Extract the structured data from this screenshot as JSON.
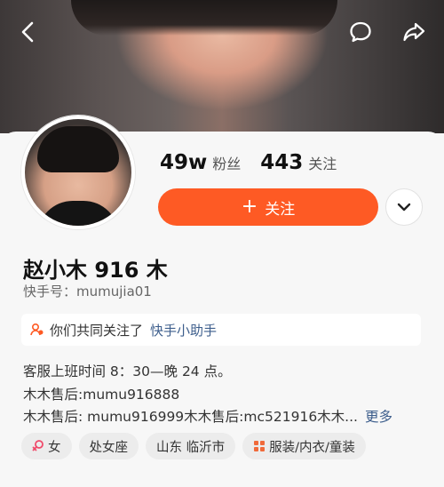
{
  "header": {
    "back_icon": "back-arrow-icon",
    "comment_icon": "comment-bubble-icon",
    "share_icon": "share-arrow-icon"
  },
  "profile": {
    "followers_count": "49w",
    "followers_label": "粉丝",
    "following_count": "443",
    "following_label": "关注",
    "follow_button_label": "关注",
    "name": "赵小木 916 木",
    "kuaishou_id": "快手号：mumujia01"
  },
  "mutual": {
    "text": "你们共同关注了",
    "account": "快手小助手"
  },
  "bio": {
    "line1": "客服上班时间 8：30—晚 24 点。",
    "line2": "木木售后:mumu916888",
    "line3": "木木售后: mumu916999木木售后:mc521916木木...",
    "more_label": "更多"
  },
  "tags": [
    {
      "label": "女",
      "icon": "female-icon"
    },
    {
      "label": "处女座",
      "icon": ""
    },
    {
      "label": "山东 临沂市",
      "icon": ""
    },
    {
      "label": "服装/内衣/童装",
      "icon": "grid-icon"
    }
  ],
  "colors": {
    "accent": "#fe5a24",
    "link": "#3d5e8c"
  }
}
